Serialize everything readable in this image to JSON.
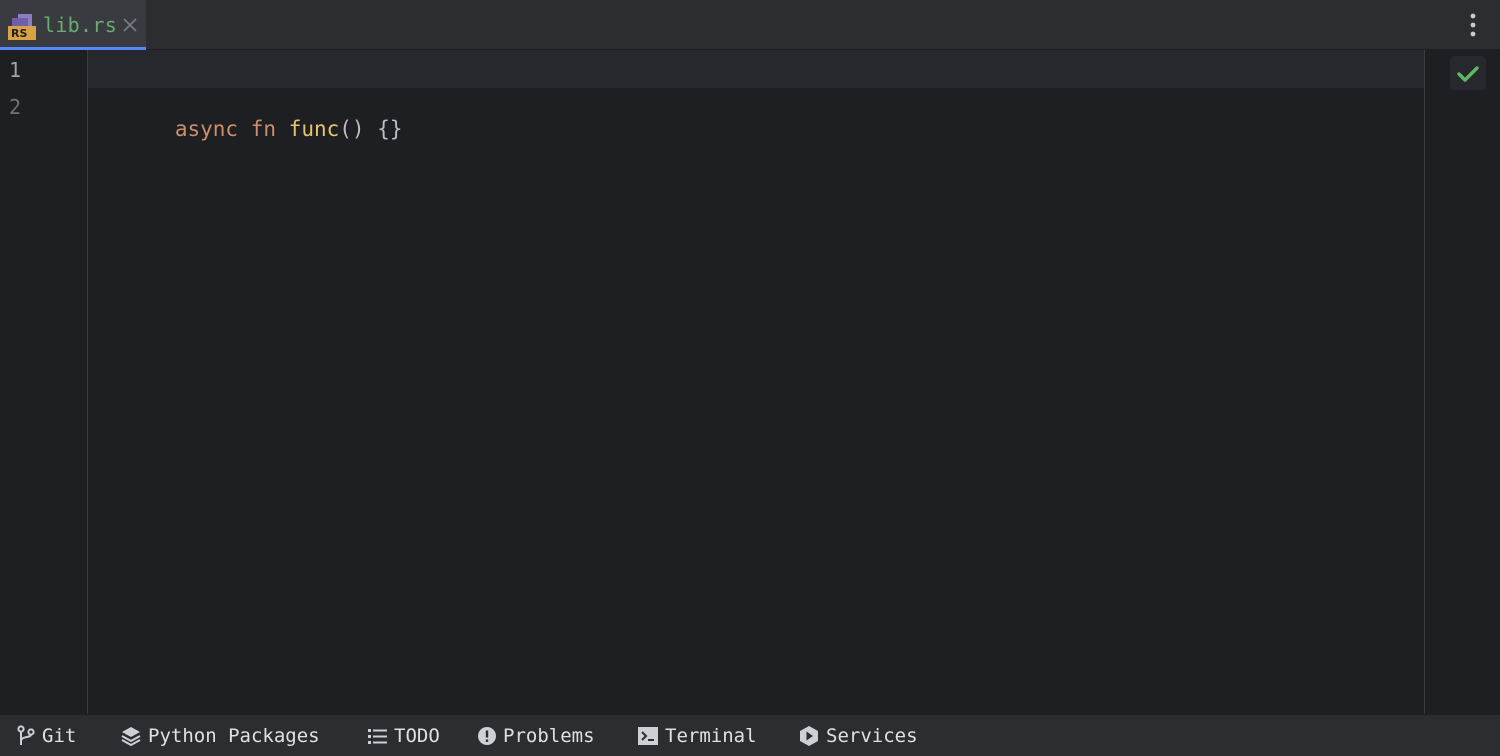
{
  "editor_tab": {
    "file_name": "lib.rs",
    "icon": "rust-file-icon",
    "icon_badge": "RS"
  },
  "gutter": {
    "line_numbers": [
      "1",
      "2"
    ]
  },
  "code": {
    "line2_keyword_async": "async",
    "line2_keyword_fn": "fn",
    "line2_function_name": "func",
    "line2_params": "()",
    "line2_body": "{}"
  },
  "inspection": {
    "status_icon": "check-icon"
  },
  "tool_windows": [
    {
      "label": "Git",
      "icon": "git-branch-icon"
    },
    {
      "label": "Python Packages",
      "icon": "layers-icon"
    },
    {
      "label": "TODO",
      "icon": "list-icon"
    },
    {
      "label": "Problems",
      "icon": "exclamation-circle-icon"
    },
    {
      "label": "Terminal",
      "icon": "terminal-icon"
    },
    {
      "label": "Services",
      "icon": "play-circle-icon"
    }
  ],
  "colors": {
    "keyword": "#cf8e6d",
    "function_name": "#e8c46c",
    "file_name_tab": "#6aab73",
    "active_tab_underline": "#548af7",
    "success_check": "#5fb865"
  }
}
